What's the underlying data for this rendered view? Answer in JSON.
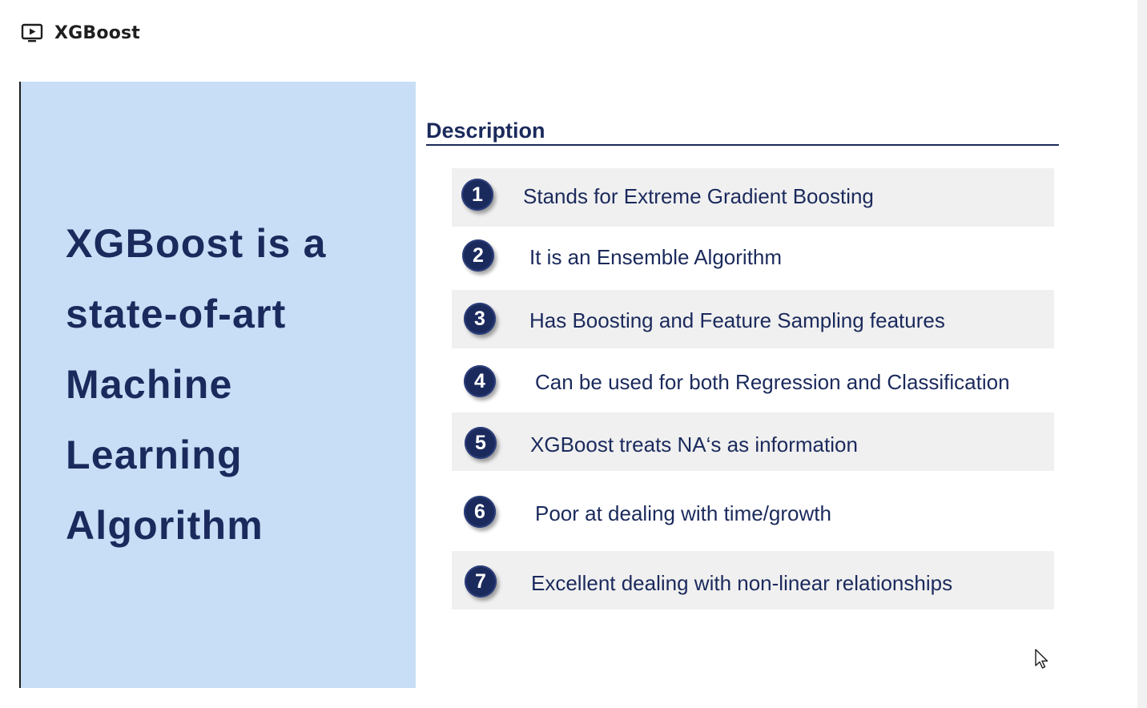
{
  "header": {
    "icon": "presentation-play-icon",
    "title": "XGBoost"
  },
  "slide": {
    "left_panel": {
      "background": "#c8def6",
      "headline_lines": [
        "XGBoost is a",
        "state-of-art",
        "Machine",
        "Learning",
        "Algorithm"
      ]
    },
    "description": {
      "title": "Description",
      "items": [
        {
          "number": "1",
          "text": "Stands for Extreme Gradient Boosting"
        },
        {
          "number": "2",
          "text": "It is an Ensemble Algorithm"
        },
        {
          "number": "3",
          "text": "Has Boosting and Feature Sampling features"
        },
        {
          "number": "4",
          "text": "Can be used for both Regression and Classification"
        },
        {
          "number": "5",
          "text": "XGBoost treats NA‘s as information"
        },
        {
          "number": "6",
          "text": "Poor at dealing with time/growth"
        },
        {
          "number": "7",
          "text": "Excellent dealing with non-linear relationships"
        }
      ]
    }
  },
  "colors": {
    "accent": "#1b2a5c",
    "row_shade": "#f0f0f0"
  }
}
